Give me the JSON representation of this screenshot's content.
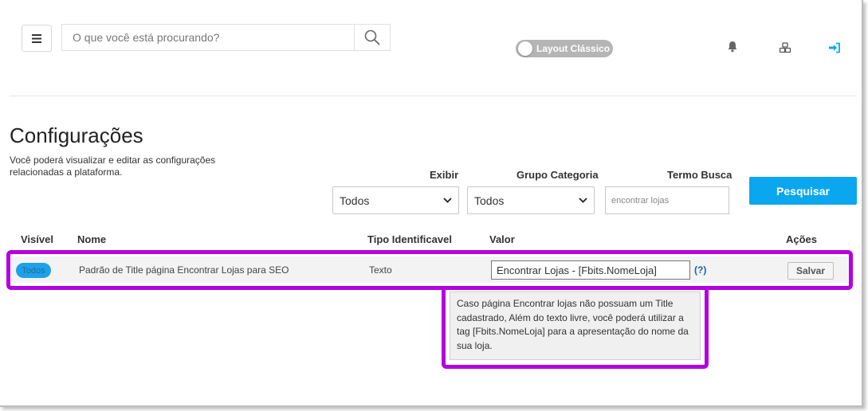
{
  "header": {
    "search_placeholder": "O que você está procurando?",
    "layout_toggle_label": "Layout Clássico",
    "icons": [
      "menu-icon",
      "search-icon",
      "bell-icon",
      "cubes-icon",
      "sign-in-icon"
    ],
    "accent_color": "#0aa7ef"
  },
  "page": {
    "title": "Configurações",
    "description": "Você poderá visualizar e editar as configurações relacionadas a plataforma."
  },
  "filters": {
    "exibir_label": "Exibir",
    "exibir_value": "Todos",
    "grupo_label": "Grupo Categoria",
    "grupo_value": "Todos",
    "termo_label": "Termo Busca",
    "termo_value": "encontrar lojas",
    "search_button": "Pesquisar"
  },
  "table": {
    "columns": [
      "Visível",
      "Nome",
      "Tipo Identificavel",
      "Valor",
      "Ações"
    ],
    "rows": [
      {
        "visivel": "Todos",
        "nome": "Padrão de Title página Encontrar Lojas para SEO",
        "tipo": "Texto",
        "valor": "Encontrar Lojas - [Fbits.NomeLoja]",
        "help": "(?)",
        "action": "Salvar"
      }
    ]
  },
  "tooltip": {
    "text": "Caso página Encontrar lojas não possuam um Title cadastrado, Além do texto livre, você poderá utilizar a tag [Fbits.NomeLoja] para a apresentação do nome da sua loja."
  },
  "highlight_color": "#b400e0"
}
